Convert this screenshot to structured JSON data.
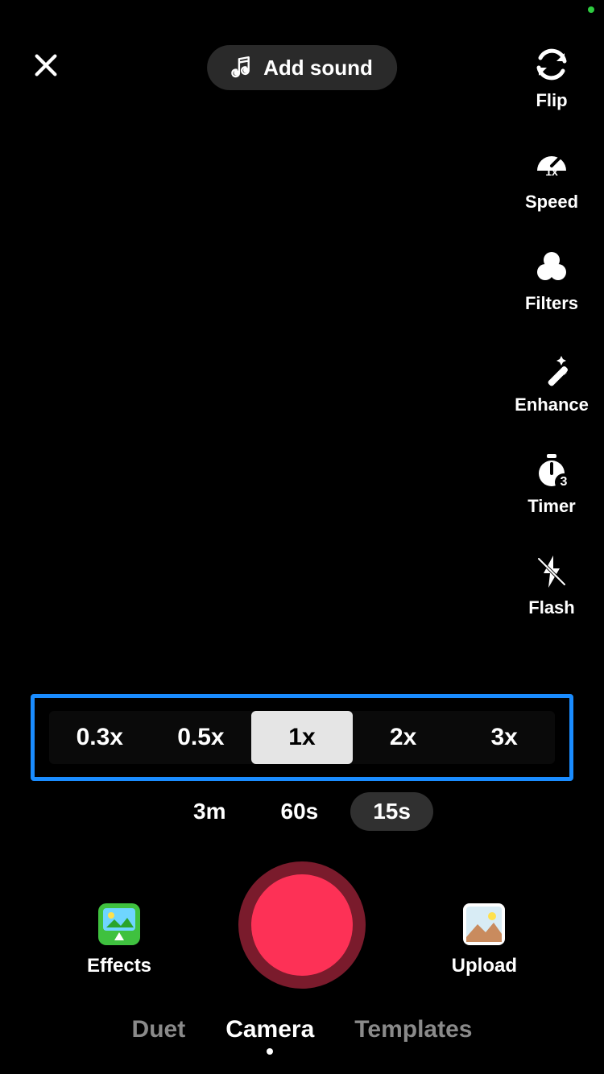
{
  "header": {
    "add_sound_label": "Add sound"
  },
  "right_rail": {
    "items": [
      {
        "label": "Flip"
      },
      {
        "label": "Speed"
      },
      {
        "label": "Filters"
      },
      {
        "label": "Enhance"
      },
      {
        "label": "Timer"
      },
      {
        "label": "Flash"
      }
    ],
    "speed_badge": "1x",
    "timer_badge": "3"
  },
  "speed_selector": {
    "options": [
      "0.3x",
      "0.5x",
      "1x",
      "2x",
      "3x"
    ],
    "selected": "1x"
  },
  "duration_selector": {
    "options": [
      "3m",
      "60s",
      "15s"
    ],
    "selected": "15s"
  },
  "bottom": {
    "effects_label": "Effects",
    "upload_label": "Upload"
  },
  "mode_tabs": {
    "items": [
      "Duet",
      "Camera",
      "Templates"
    ],
    "active": "Camera"
  },
  "colors": {
    "highlight_border": "#1a8cff",
    "record_inner": "#fd3156",
    "record_outer": "#7a1b2c"
  }
}
